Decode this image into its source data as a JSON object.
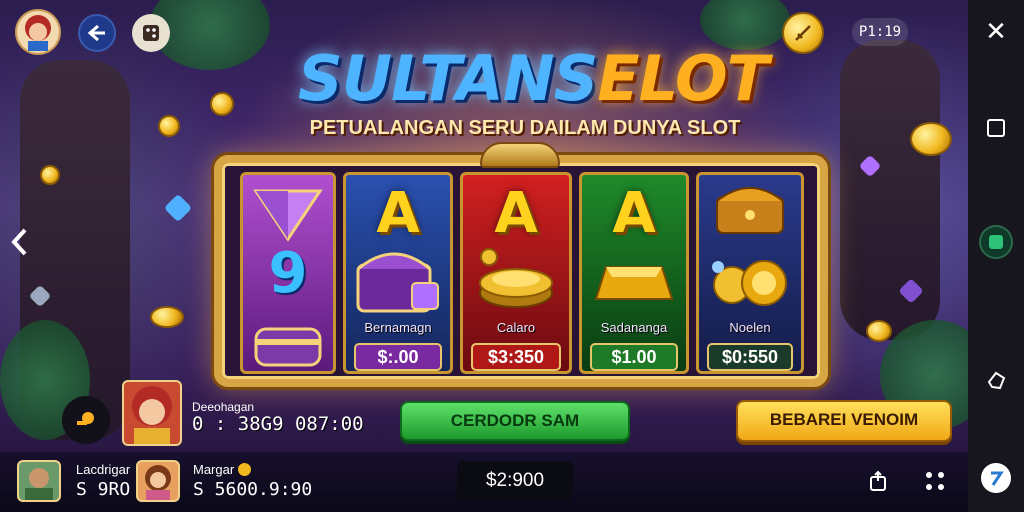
{
  "title": {
    "part1": "SULTANS",
    "part2": "ELOT"
  },
  "subtitle": "PETUALANGAN SERU DAILAM DUNYA SLOT",
  "top_left": {
    "back_icon": "back-arrow-icon",
    "menu_icon": "dice-icon"
  },
  "top_right": {
    "counter": "P1:19"
  },
  "reels": [
    {
      "symbol": "9",
      "name": "",
      "price": ""
    },
    {
      "symbol": "A",
      "name": "Bernamagn",
      "price": "$:.00"
    },
    {
      "symbol": "A",
      "name": "Calaro",
      "price": "$3:350"
    },
    {
      "symbol": "A",
      "name": "Sadananga",
      "price": "$1.00"
    },
    {
      "symbol": "",
      "name": "Noelen",
      "price": "$0:550"
    }
  ],
  "player": {
    "name": "Deeohagan",
    "count": "0 : 38G9 087:00"
  },
  "buttons": {
    "green": "CERDODR SAM",
    "yellow": "BEBAREI VENOIM"
  },
  "bottom": {
    "user1_label": "Lacdrigar",
    "user1_value": "S 9RO",
    "user2_label": "Margar",
    "user2_value": "S 5600.9:90",
    "balance": "$2:900"
  },
  "sidebar": {
    "close": "✕"
  }
}
